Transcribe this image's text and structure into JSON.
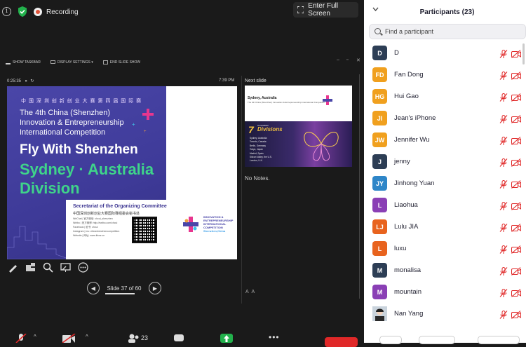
{
  "top_bar": {
    "recording_label": "Recording",
    "fullscreen_label": "Enter Full Screen"
  },
  "toolbar": {
    "show_taskbar": "SHOW TASKBAR",
    "display_settings": "DISPLAY SETTINGS ▾",
    "end_slide_show": "END SLIDE SHOW"
  },
  "presenter": {
    "elapsed_time": "0:25:35",
    "clock": "7:39 PM",
    "next_slide_label": "Next slide",
    "notes": "No Notes.",
    "slide_counter": "Slide 37 of 60"
  },
  "current_slide": {
    "chinese_title": "中 国 深 圳 创 新 创 业 大 赛 第 四 届 国 际 赛",
    "title_line1": "The 4th China (Shenzhen)",
    "title_line2": "Innovation & Entrepreneurship",
    "title_line3": "International Competition",
    "headline": "Fly With Shenzhen",
    "division_line1": "Sydney · Australia",
    "division_line2": "Division",
    "secretariat": "Secretariat of the Organizing Committee",
    "secretariat_cn": "中国深圳创新创业大赛国际赛组委会秘书处",
    "contacts": [
      "WeChat | 官方微信: chcui_shenzhen",
      "Weibo | 官方微博: http://weibo.com/chcui",
      "Facebook | 脸书: chcui",
      "Instagram | ins: chinashenzhencompetition",
      "Website | 网址: www.iitcsz.cn"
    ],
    "logo_text": "INNOVATION & ENTREPRENEURSHIP INTERNATIONAL COMPETITION",
    "logo_sub": "Shenzhen,China"
  },
  "next_slide": {
    "title": "Sydney, Australia",
    "subtitle": "The 4th China (Shenzhen) Innovation & Entrepreneurship International Competition",
    "number": "7",
    "competition": "Competition",
    "divisions": "Divisions",
    "cities": [
      "Sydney, Australia",
      "Toronto, Canada",
      "Berlin, Germany",
      "Tokyo, Japan",
      "Madrid, Spain",
      "Silicon Valley, the U.S.",
      "London, U.K."
    ]
  },
  "bottom_bar": {
    "participant_count": "23"
  },
  "participants_panel": {
    "title": "Participants (23)",
    "search_placeholder": "Find a participant",
    "participants": [
      {
        "initials": "D",
        "name": "D",
        "color": "#2d3e55"
      },
      {
        "initials": "FD",
        "name": "Fan Dong",
        "color": "#f0a01e"
      },
      {
        "initials": "HG",
        "name": "Hui Gao",
        "color": "#f0a01e"
      },
      {
        "initials": "JI",
        "name": "Jean's iPhone",
        "color": "#f0a01e"
      },
      {
        "initials": "JW",
        "name": "Jennifer Wu",
        "color": "#f0a01e"
      },
      {
        "initials": "J",
        "name": "jenny",
        "color": "#2d3e55"
      },
      {
        "initials": "JY",
        "name": "Jinhong Yuan",
        "color": "#2e86c8"
      },
      {
        "initials": "L",
        "name": "Liaohua",
        "color": "#8a3fb5"
      },
      {
        "initials": "LJ",
        "name": "Lulu JIA",
        "color": "#e8631e"
      },
      {
        "initials": "L",
        "name": "luxu",
        "color": "#e8631e"
      },
      {
        "initials": "M",
        "name": "monalisa",
        "color": "#2d3e55"
      },
      {
        "initials": "M",
        "name": "mountain",
        "color": "#8a3fb5"
      },
      {
        "initials": "",
        "name": "Nan Yang",
        "color": "#c9d3dc"
      }
    ]
  }
}
